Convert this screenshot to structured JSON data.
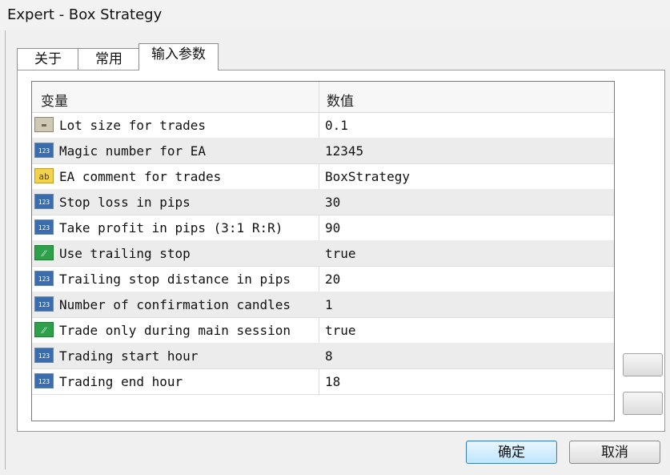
{
  "window": {
    "title": "Expert - Box Strategy"
  },
  "tabs": [
    {
      "label": "关于"
    },
    {
      "label": "常用"
    },
    {
      "label": "输入参数",
      "active": true
    }
  ],
  "grid": {
    "header": {
      "variable": "变量",
      "value": "数值"
    },
    "rows": [
      {
        "icon": "double-icon",
        "name": "Lot size for trades",
        "value": "0.1"
      },
      {
        "icon": "integer-icon",
        "name": "Magic number for EA",
        "value": "12345"
      },
      {
        "icon": "string-icon",
        "name": "EA comment for trades",
        "value": "BoxStrategy"
      },
      {
        "icon": "integer-icon",
        "name": "Stop loss in pips",
        "value": "30"
      },
      {
        "icon": "integer-icon",
        "name": "Take profit in pips (3:1 R:R)",
        "value": "90"
      },
      {
        "icon": "bool-icon",
        "name": "Use trailing stop",
        "value": "true"
      },
      {
        "icon": "integer-icon",
        "name": "Trailing stop distance in pips",
        "value": "20"
      },
      {
        "icon": "integer-icon",
        "name": "Number of confirmation candles",
        "value": "1"
      },
      {
        "icon": "bool-icon",
        "name": "Trade only during main session",
        "value": "true"
      },
      {
        "icon": "integer-icon",
        "name": "Trading start hour",
        "value": "8"
      },
      {
        "icon": "integer-icon",
        "name": "Trading end hour",
        "value": "18"
      }
    ]
  },
  "icon_glyphs": {
    "integer": "123",
    "string": "ab",
    "bool": "⁄⁄",
    "double": "▬"
  },
  "buttons": {
    "ok_label": "确定",
    "cancel_label": "取消"
  }
}
